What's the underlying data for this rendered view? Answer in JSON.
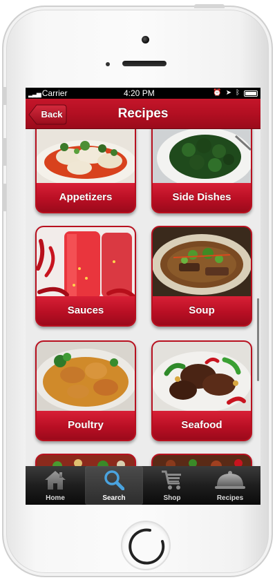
{
  "status_bar": {
    "carrier": "Carrier",
    "time": "4:20 PM"
  },
  "nav": {
    "back_label": "Back",
    "title": "Recipes"
  },
  "categories": [
    {
      "label": "Appetizers",
      "icon": "dumplings-photo"
    },
    {
      "label": "Side Dishes",
      "icon": "greens-photo"
    },
    {
      "label": "Sauces",
      "icon": "chili-sauce-photo"
    },
    {
      "label": "Soup",
      "icon": "soup-photo"
    },
    {
      "label": "Poultry",
      "icon": "curry-chicken-photo"
    },
    {
      "label": "Seafood",
      "icon": "stir-fry-photo"
    }
  ],
  "tabs": [
    {
      "label": "Home",
      "icon": "house-icon",
      "active": false
    },
    {
      "label": "Search",
      "icon": "magnifier-icon",
      "active": true
    },
    {
      "label": "Shop",
      "icon": "cart-icon",
      "active": false
    },
    {
      "label": "Recipes",
      "icon": "cloche-icon",
      "active": false
    }
  ],
  "colors": {
    "accent_red": "#b90f24",
    "tabbar": "#1e1e1e",
    "search_icon": "#4aa3df"
  }
}
